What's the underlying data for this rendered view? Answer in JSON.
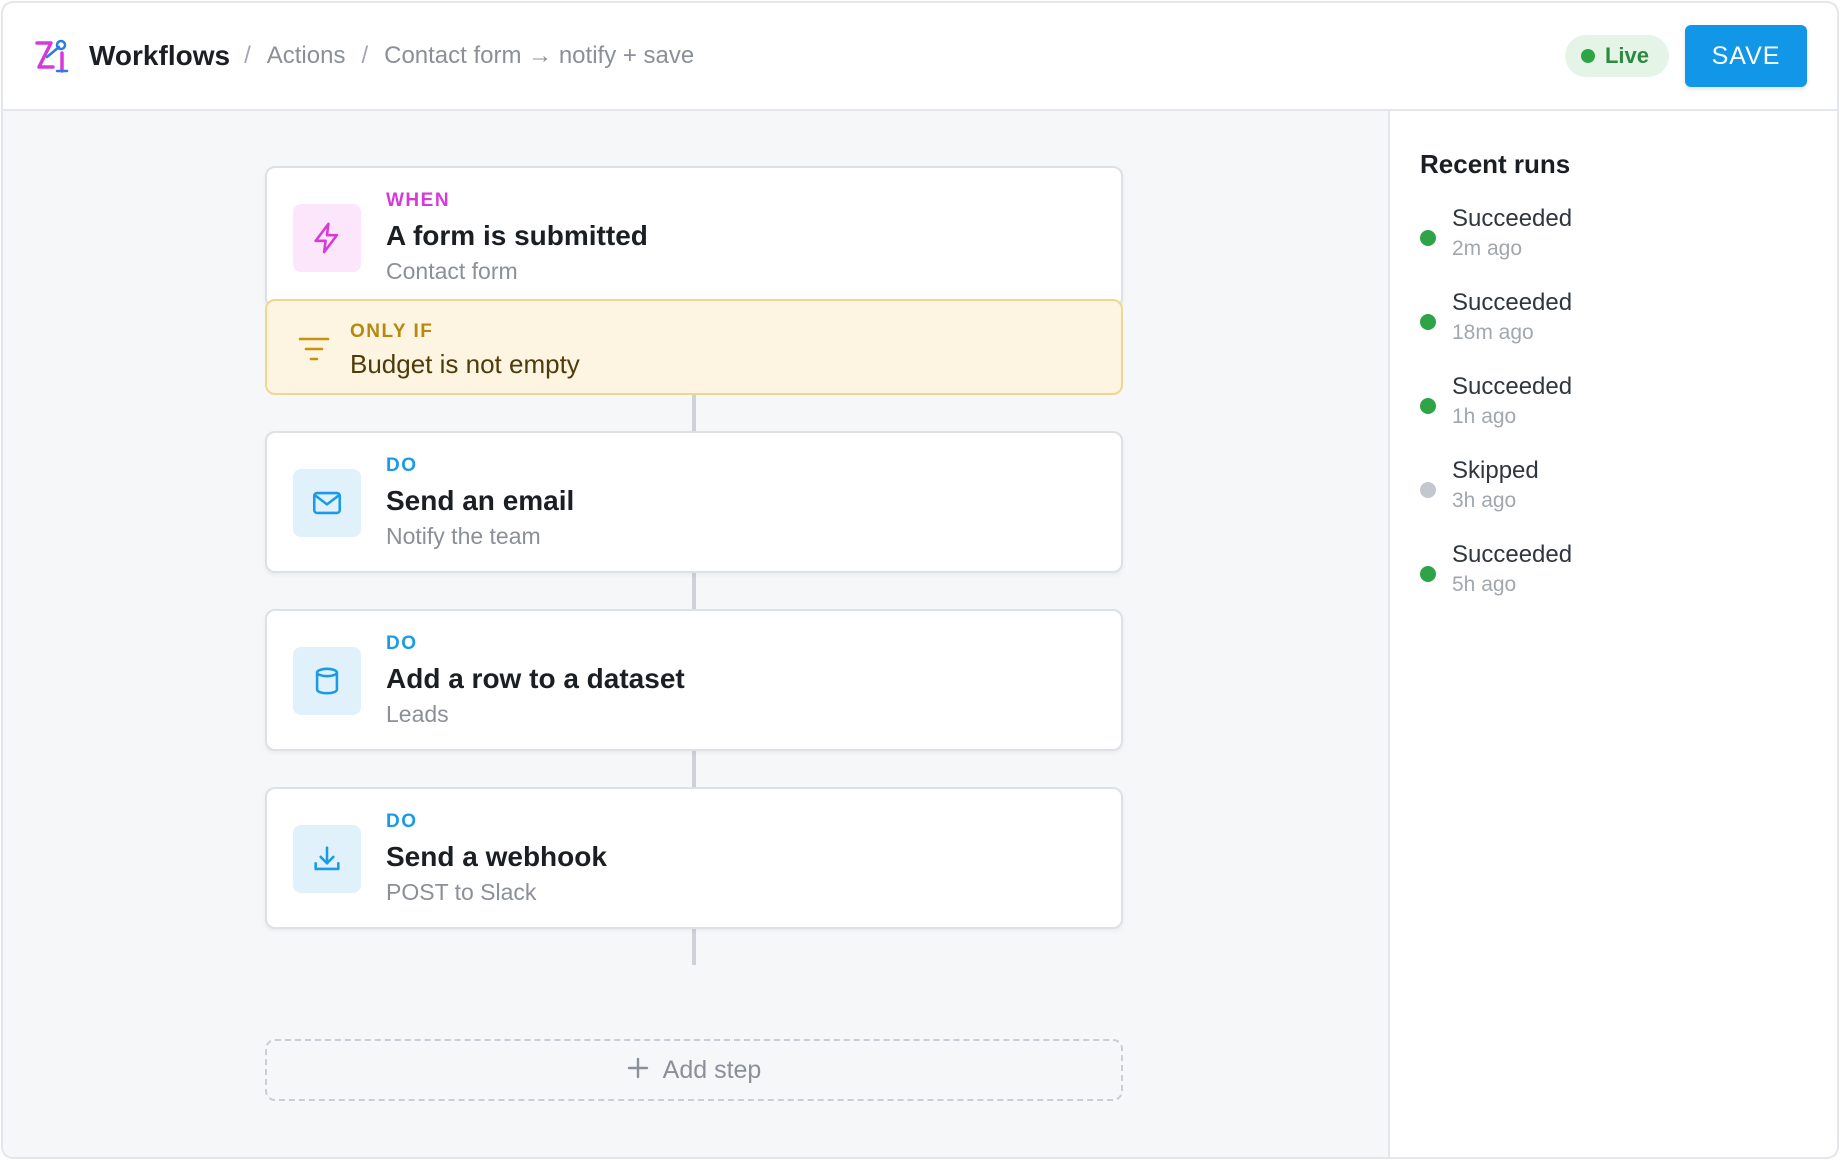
{
  "header": {
    "brand": "Workflows",
    "breadcrumb": [
      "Actions",
      "Contact form → notify + save"
    ],
    "separator": "/",
    "live_label": "Live",
    "save_label": "SAVE"
  },
  "steps": {
    "trigger": {
      "kicker": "WHEN",
      "title": "A form is submitted",
      "subtitle": "Contact form",
      "icon": "lightning-icon"
    },
    "condition": {
      "kicker": "ONLY IF",
      "title": "Budget is not empty",
      "icon": "filter-icon"
    },
    "actions": [
      {
        "kicker": "DO",
        "title": "Send an email",
        "subtitle": "Notify the team",
        "icon": "mail-icon"
      },
      {
        "kicker": "DO",
        "title": "Add a row to a dataset",
        "subtitle": "Leads",
        "icon": "database-icon"
      },
      {
        "kicker": "DO",
        "title": "Send a webhook",
        "subtitle": "POST to Slack",
        "icon": "download-icon"
      }
    ],
    "add_step_label": "Add step"
  },
  "recent_runs": {
    "title": "Recent runs",
    "items": [
      {
        "status": "Succeeded",
        "time": "2m ago",
        "state": "success"
      },
      {
        "status": "Succeeded",
        "time": "18m ago",
        "state": "success"
      },
      {
        "status": "Succeeded",
        "time": "1h ago",
        "state": "success"
      },
      {
        "status": "Skipped",
        "time": "3h ago",
        "state": "skipped"
      },
      {
        "status": "Succeeded",
        "time": "5h ago",
        "state": "success"
      }
    ]
  },
  "colors": {
    "accent": "#1296e8",
    "trigger": "#d63ad8",
    "condition": "#b7880f",
    "success": "#2fa447",
    "skipped": "#c4c8ce"
  }
}
